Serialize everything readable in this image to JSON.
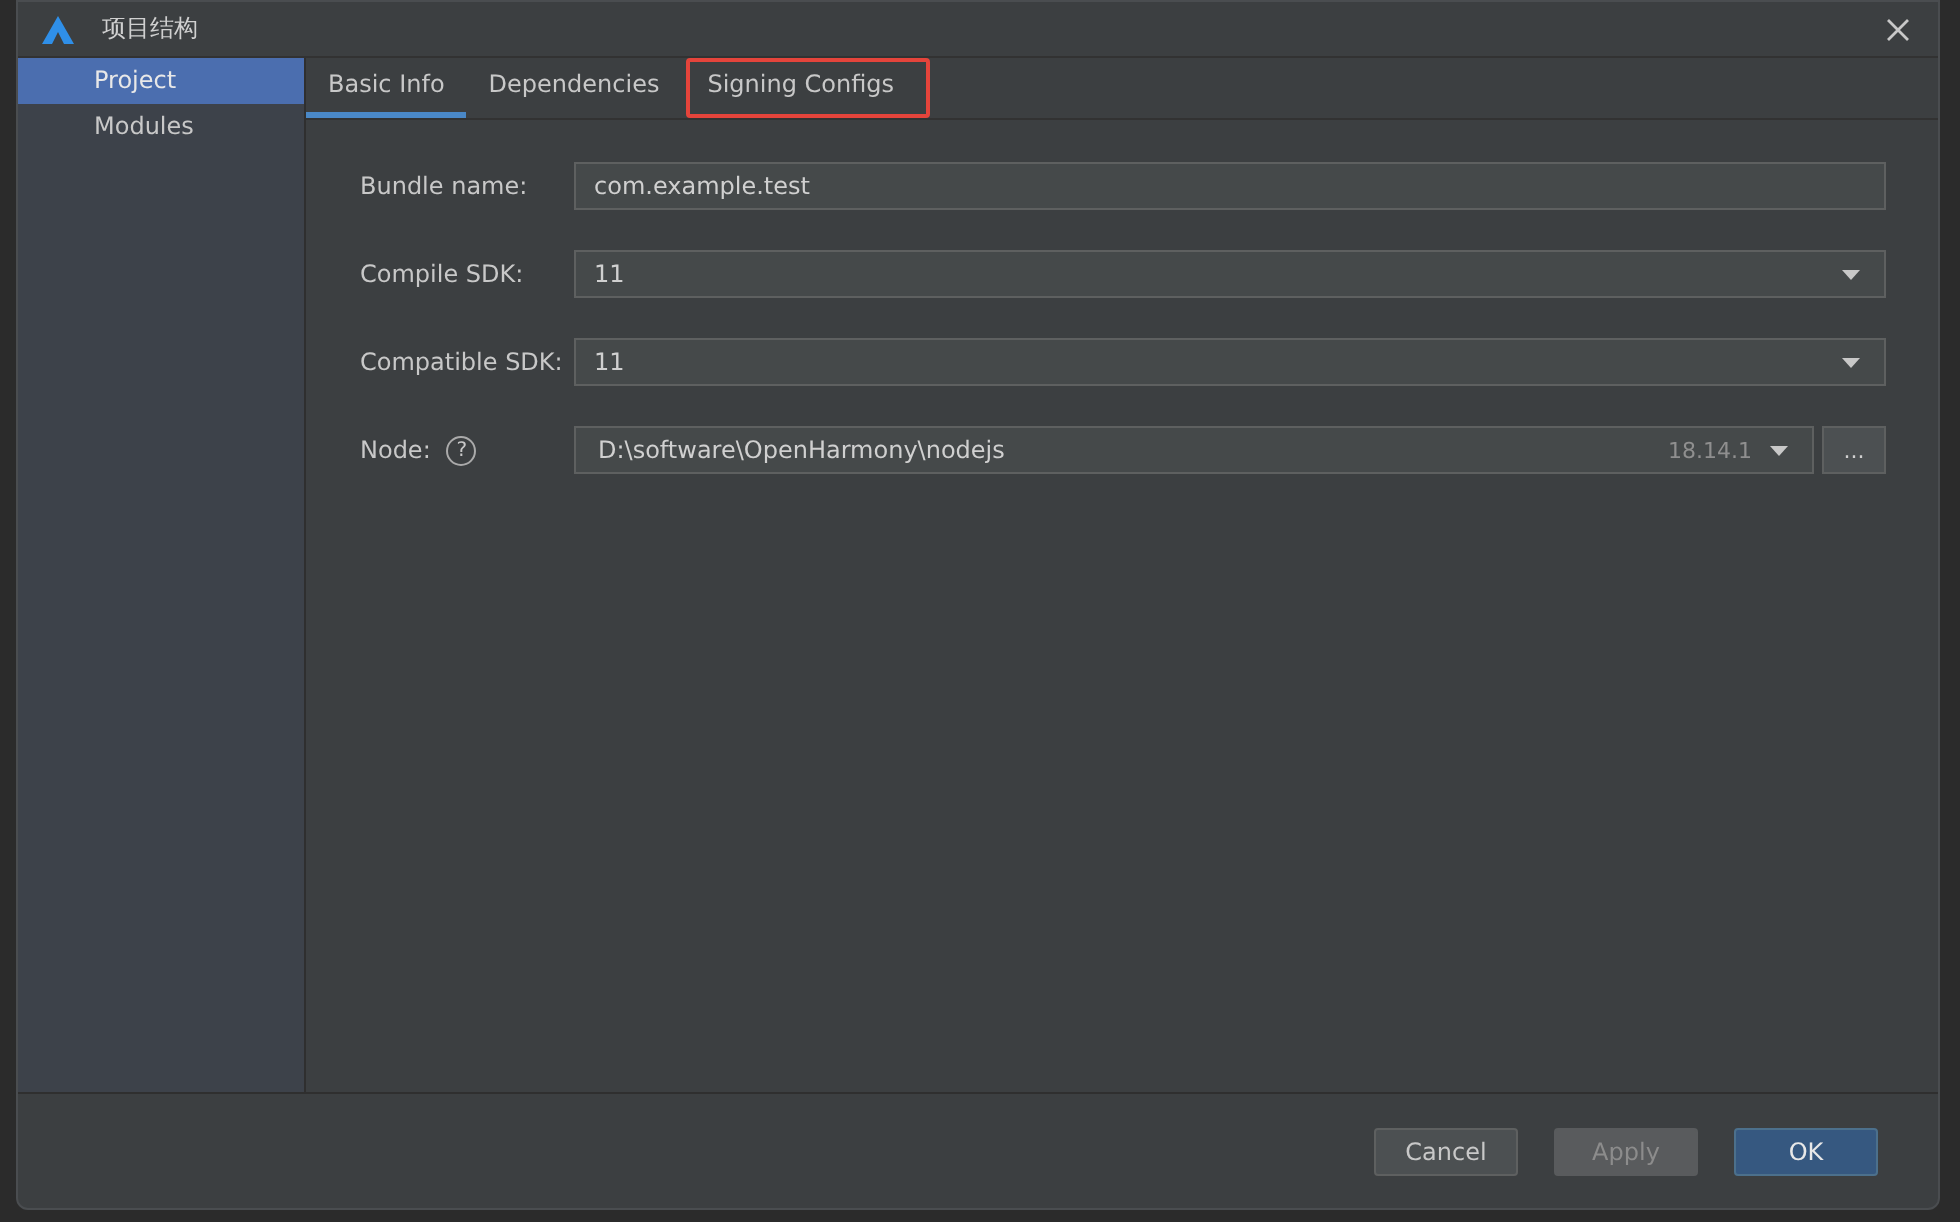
{
  "window": {
    "title": "项目结构"
  },
  "sidebar": {
    "items": [
      {
        "label": "Project",
        "selected": true
      },
      {
        "label": "Modules",
        "selected": false
      }
    ]
  },
  "tabs": [
    {
      "label": "Basic Info",
      "selected": true,
      "highlighted": false
    },
    {
      "label": "Dependencies",
      "selected": false,
      "highlighted": false
    },
    {
      "label": "Signing Configs",
      "selected": false,
      "highlighted": true
    }
  ],
  "form": [
    {
      "kind": "text",
      "label": "Bundle name:",
      "value": "com.example.test"
    },
    {
      "kind": "select",
      "label": "Compile SDK:",
      "value": "11"
    },
    {
      "kind": "select",
      "label": "Compatible SDK:",
      "value": "11"
    },
    {
      "kind": "path",
      "label": "Node:",
      "help": "?",
      "value": "D:\\software\\OpenHarmony\\nodejs",
      "version": "18.14.1",
      "browse": "..."
    }
  ],
  "buttons": [
    {
      "label": "Cancel",
      "kind": "normal",
      "disabled": false
    },
    {
      "label": "Apply",
      "kind": "normal",
      "disabled": true
    },
    {
      "label": "OK",
      "kind": "primary",
      "disabled": false
    }
  ]
}
